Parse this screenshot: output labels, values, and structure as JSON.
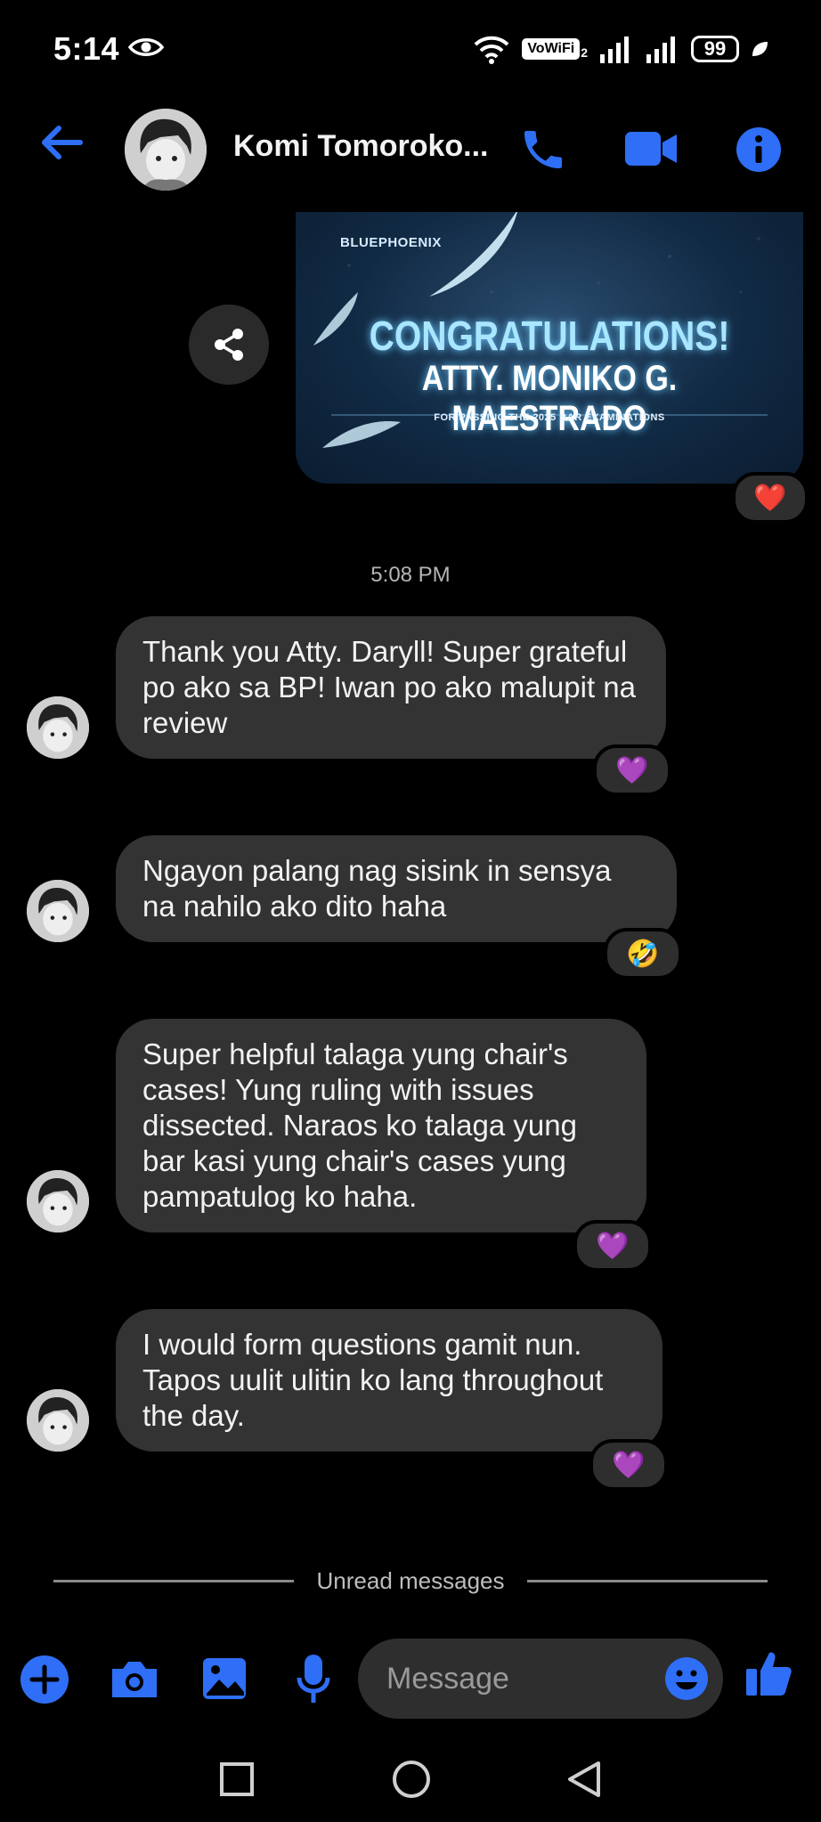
{
  "status_bar": {
    "time": "5:14",
    "vowifi": "VoWiFi",
    "vowifi_sub": "2",
    "battery": "99"
  },
  "header": {
    "contact_name": "Komi Tomoroko..."
  },
  "image_card": {
    "brand": "BLUEPHOENIX",
    "title": "CONGRATULATIONS!",
    "name": "ATTY. MONIKO G. MAESTRADO",
    "subtitle": "FOR PASSING THE 2025 BAR EXAMINATIONS",
    "reaction": "❤️"
  },
  "timestamp": "5:08 PM",
  "messages": [
    {
      "text": "Thank you Atty. Daryll! Super grateful po ako sa BP! Iwan po ako malupit na review",
      "reaction": "💜"
    },
    {
      "text": "Ngayon palang nag sisink in sensya na nahilo ako dito haha",
      "reaction": "🤣"
    },
    {
      "text": "Super helpful talaga yung chair's cases! Yung ruling with issues dissected. Naraos ko talaga yung bar kasi yung chair's cases yung pampatulog ko haha.",
      "reaction": "💜"
    },
    {
      "text": "I would form questions gamit nun. Tapos uulit ulitin ko lang throughout the day.",
      "reaction": "💜"
    }
  ],
  "unread_label": "Unread messages",
  "composer": {
    "placeholder": "Message"
  },
  "colors": {
    "accent": "#2f6ef6",
    "bubble": "#333333",
    "background": "#000000"
  }
}
